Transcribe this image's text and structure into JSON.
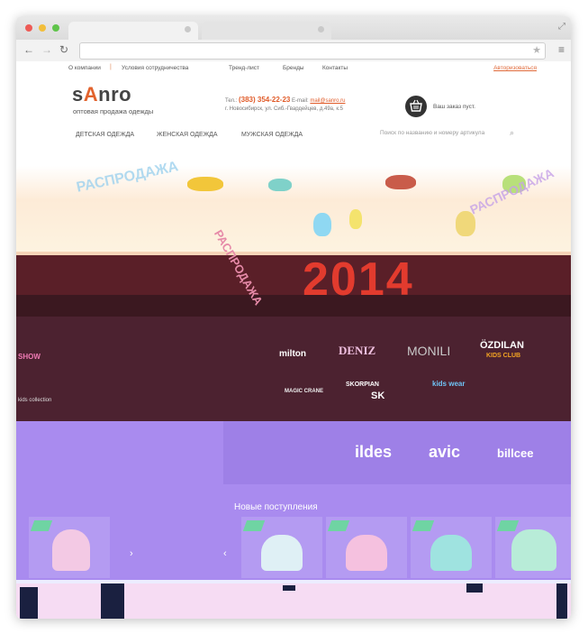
{
  "colors": {
    "accent": "#e2632d",
    "dark": "#333333",
    "banner_dark": "#5a1f28",
    "purple": "#a98bef"
  },
  "topbar": {
    "items": [
      "О компании",
      "Условия сотрудничества",
      "Тренд-лист",
      "Бренды",
      "Контакты"
    ],
    "login": "Авторизоваться"
  },
  "header": {
    "logo_s": "s",
    "logo_a": "A",
    "logo_rest": "nro",
    "tagline": "оптовая продажа одежды",
    "tel_label": "Тел.:",
    "tel": "(383) 354-22-23",
    "email_label": "E-mail:",
    "email": "mail@sanro.ru",
    "address": "г. Новосибирск, ул. Сиб.-Гвардейцев, д.49а, к.5",
    "cart_icon": "basket-icon",
    "cart_text": "Ваш заказ пуст."
  },
  "nav": {
    "items": [
      "ДЕТСКАЯ ОДЕЖДА",
      "ЖЕНСКАЯ ОДЕЖДА",
      "МУЖСКАЯ ОДЕЖДА"
    ],
    "search_placeholder": "Поиск по названию и номеру артикула",
    "search_icon": "magnifier-icon"
  },
  "banner": {
    "year": "2014",
    "sale_text": "РАСПРОДАЖА"
  },
  "brands": {
    "left": [
      "SHOW",
      "kids collection"
    ],
    "row1": [
      "milton",
      "DENIZ",
      "MONILI",
      "ÖZDILAN",
      "KIDS CLUB"
    ],
    "row2": [
      "MAGIC CRANE",
      "SKORPIAN",
      "SK",
      "kids wear"
    ],
    "row3": [
      "ildes",
      "avic",
      "billcee"
    ]
  },
  "new_arrivals": {
    "title": "Новые поступления"
  }
}
